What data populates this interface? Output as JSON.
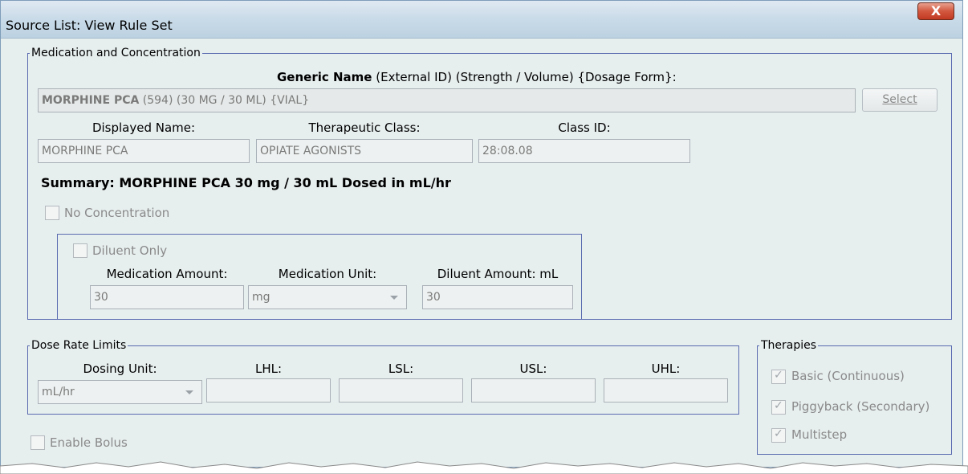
{
  "window": {
    "title": "Source List:  View Rule Set",
    "close_glyph": "X"
  },
  "medication": {
    "legend": "Medication and Concentration",
    "generic_header_bold": "Generic Name",
    "generic_header_rest": "(External ID)  (Strength / Volume)  {Dosage Form}:",
    "generic_value_bold": "MORPHINE PCA",
    "generic_value_rest": " (594) (30 MG / 30 ML) {VIAL}",
    "select_label": "Select",
    "displayed_name_label": "Displayed Name:",
    "displayed_name_value": "MORPHINE PCA",
    "therapeutic_class_label": "Therapeutic Class:",
    "therapeutic_class_value": "OPIATE AGONISTS",
    "class_id_label": "Class ID:",
    "class_id_value": "28:08.08",
    "summary": "Summary:  MORPHINE PCA 30 mg / 30 mL Dosed in mL/hr",
    "no_concentration_label": "No Concentration",
    "no_concentration_checked": false
  },
  "diluent": {
    "diluent_only_label": "Diluent Only",
    "diluent_only_checked": false,
    "medication_amount_label": "Medication Amount:",
    "medication_amount_value": "30",
    "medication_unit_label": "Medication Unit:",
    "medication_unit_value": "mg",
    "diluent_amount_label": "Diluent Amount: mL",
    "diluent_amount_value": "30"
  },
  "dose_rate": {
    "legend": "Dose Rate Limits",
    "dosing_unit_label": "Dosing Unit:",
    "dosing_unit_value": "mL/hr",
    "lhl_label": "LHL:",
    "lhl_value": "",
    "lsl_label": "LSL:",
    "lsl_value": "",
    "usl_label": "USL:",
    "usl_value": "",
    "uhl_label": "UHL:",
    "uhl_value": ""
  },
  "therapies": {
    "legend": "Therapies",
    "items": [
      {
        "label": "Basic (Continuous)",
        "checked": true
      },
      {
        "label": "Piggyback (Secondary)",
        "checked": true
      },
      {
        "label": "Multistep",
        "checked": true
      }
    ]
  },
  "bolus": {
    "enable_bolus_label": "Enable Bolus",
    "checked": false
  },
  "colors": {
    "window_bg": "#e7eeee",
    "group_border": "#5a6bb0",
    "close_red": "#c23a22",
    "disabled_text": "#7a7a7a"
  }
}
